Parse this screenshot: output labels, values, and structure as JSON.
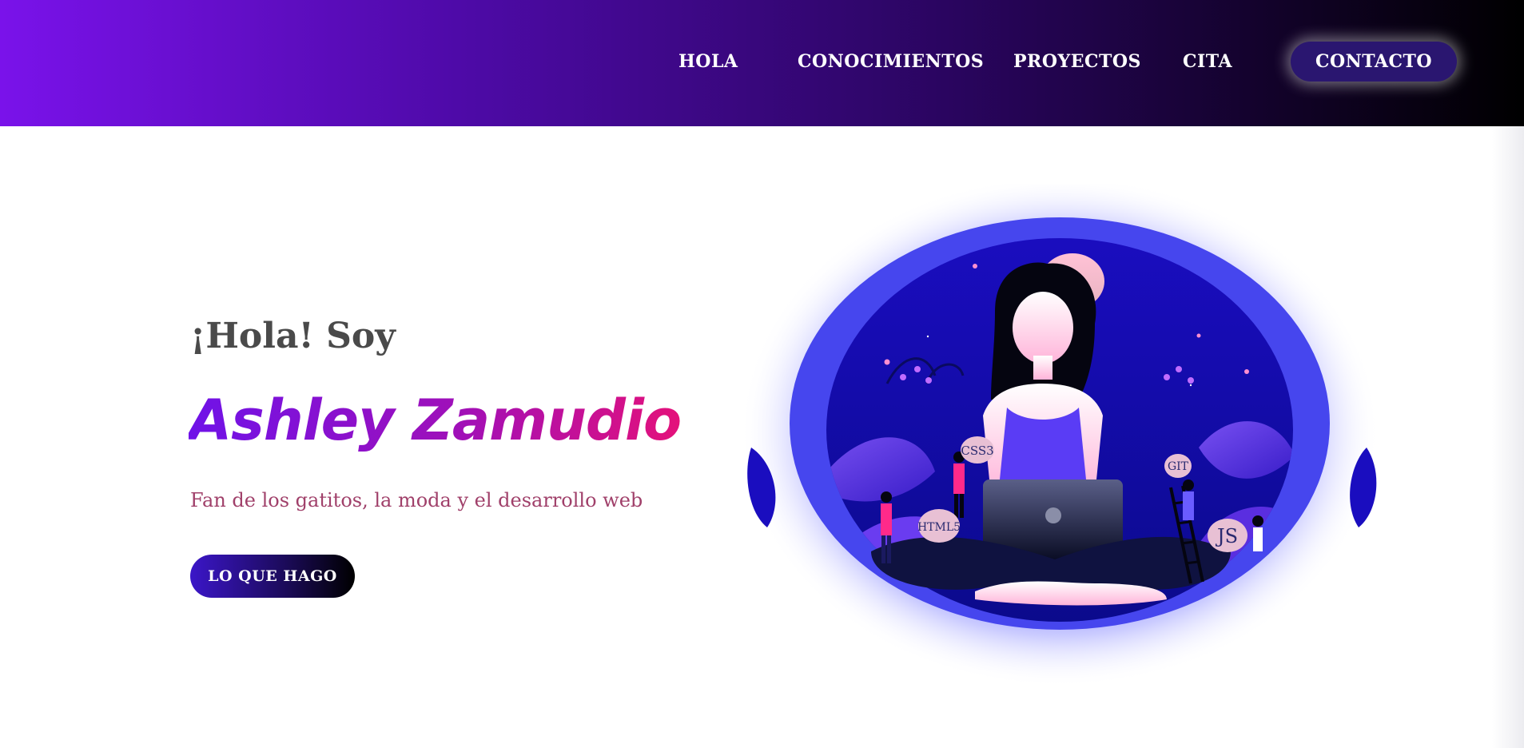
{
  "nav": {
    "items": [
      {
        "label": "HOLA"
      },
      {
        "label": "CONOCIMIENTOS"
      },
      {
        "label": "PROYECTOS"
      },
      {
        "label": "CITA"
      }
    ],
    "contact_label": "CONTACTO"
  },
  "hero": {
    "greeting": "¡Hola! Soy",
    "name": "Ashley Zamudio",
    "tagline": "Fan de los gatitos, la moda y el desarrollo web",
    "cta_label": "LO QUE HAGO"
  },
  "illustration": {
    "bubbles": {
      "css": "CSS3",
      "git": "GIT",
      "html": "HTML5",
      "js": "JS"
    }
  },
  "colors": {
    "header_start": "#7a12ea",
    "header_end": "#000000",
    "contact_button": "#2a1670",
    "name_gradient_start": "#6f12e8",
    "name_gradient_end": "#e4117a",
    "tagline": "#a0406a",
    "greeting": "#4a4a4a"
  }
}
